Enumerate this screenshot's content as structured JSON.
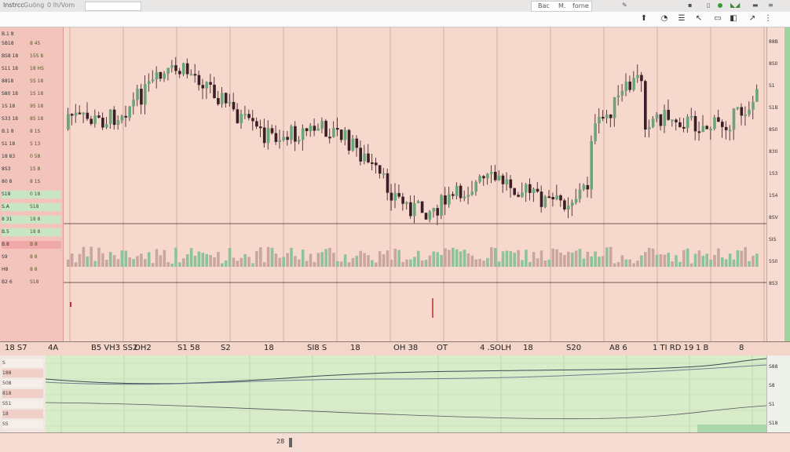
{
  "window": {
    "title_left": "Instrcc",
    "title_text": "Guöng",
    "title_text2": "0 lh/Vom",
    "tab1": "Bac",
    "tab2": "M.",
    "tab3": "forne"
  },
  "toolbar": {
    "icons": [
      "cursor-icon",
      "clock-icon",
      "list-icon",
      "pointer-icon",
      "doc-icon",
      "toggle-icon",
      "pencil-icon",
      "more-icon"
    ]
  },
  "watchlist": {
    "header": "B.1 8",
    "rows": [
      {
        "left": "5B18",
        "right": "8 45"
      },
      {
        "left": "BS8 18",
        "right": "15S 8"
      },
      {
        "left": "S11 18",
        "right": "18 HS"
      },
      {
        "left": "8818",
        "right": "5S 18"
      },
      {
        "left": "S80 18",
        "right": "1S 18"
      },
      {
        "left": "1S 18",
        "right": "95 18"
      },
      {
        "left": "S33 18",
        "right": "85 18"
      },
      {
        "left": "B.1 8",
        "right": "8 1S"
      },
      {
        "left": "S1 18",
        "right": "5 13"
      },
      {
        "left": "18 83",
        "right": "0 58"
      },
      {
        "left": "8S3",
        "right": "15 8"
      },
      {
        "left": "80 8",
        "right": "8 1S"
      },
      {
        "left": "S18",
        "right": "0 18"
      },
      {
        "left": "S.A",
        "right": "S18"
      },
      {
        "left": "8 31",
        "right": "18 8"
      },
      {
        "left": "B.5",
        "right": "18 8"
      },
      {
        "left": "B.8",
        "right": "B 8"
      },
      {
        "left": "S9",
        "right": "8 8"
      },
      {
        "left": "H8",
        "right": "8 8"
      },
      {
        "left": "B2 6",
        "right": "S18"
      }
    ]
  },
  "right_axis": {
    "labels": [
      "88B",
      "8S0",
      "S1",
      "S1B",
      "8S0",
      "830",
      "1S3",
      "1S4",
      "8SV",
      "SIS",
      "5S0",
      "8S3"
    ]
  },
  "time_axis": {
    "labels": [
      "18 S7",
      "4A",
      "B5 VH3 SS2",
      "OH2",
      "S1 58",
      "S2",
      "18",
      "SI8 S",
      "18",
      "OH 38",
      "OT",
      "4 .SOLH",
      "18",
      "S20",
      "A8 6",
      "1 TI RD 19",
      "1 B",
      "8"
    ]
  },
  "lower_panel": {
    "left_labels": [
      "S",
      "188",
      "508",
      "818",
      "SS1",
      "18",
      "SS"
    ],
    "right_labels": [
      "S88",
      "S8",
      "S1",
      "S18"
    ]
  },
  "bottom": {
    "label": "28"
  },
  "chart_data": {
    "type": "candlestick",
    "title": "",
    "xlabel": "",
    "ylabel": "",
    "colors": {
      "up": "#6aa57c",
      "down": "#3a1f27"
    },
    "grid": true,
    "volume": true
  }
}
